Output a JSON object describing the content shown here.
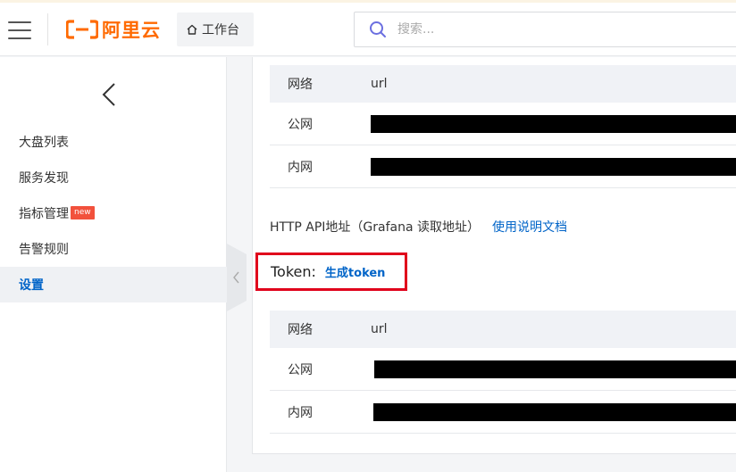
{
  "header": {
    "logo_text": "阿里云",
    "workbench_label": "工作台",
    "search_placeholder": "搜索..."
  },
  "sidebar": {
    "items": [
      {
        "label": "大盘列表"
      },
      {
        "label": "服务发现"
      },
      {
        "label": "指标管理",
        "badge": "new"
      },
      {
        "label": "告警规则"
      },
      {
        "label": "设置",
        "active": true
      }
    ]
  },
  "table1": {
    "header": {
      "col1": "网络",
      "col2": "url"
    },
    "rows": [
      {
        "network": "公网"
      },
      {
        "network": "内网"
      }
    ]
  },
  "api": {
    "label": "HTTP API地址（Grafana 读取地址）",
    "doc_link": "使用说明文档"
  },
  "token": {
    "label": "Token:",
    "generate_link": "生成token"
  },
  "table2": {
    "header": {
      "col1": "网络",
      "col2": "url"
    },
    "rows": [
      {
        "network": "公网"
      },
      {
        "network": "内网"
      }
    ]
  },
  "colors": {
    "brand": "#ff6a00",
    "link": "#0064c8",
    "highlight_box": "#e0001b",
    "badge": "#f2513c"
  }
}
